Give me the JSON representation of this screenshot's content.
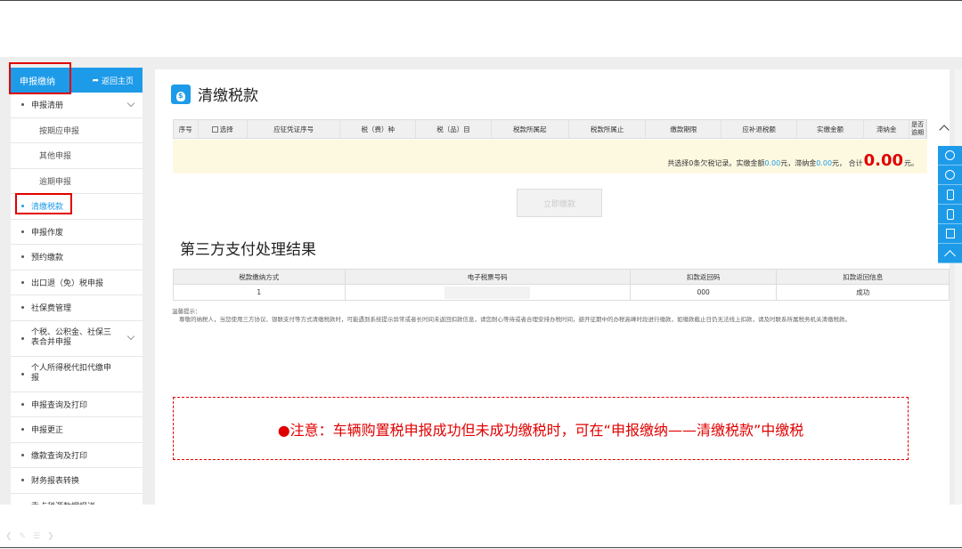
{
  "sidebar": {
    "header_title": "申报缴纳",
    "back_label": "返回主页",
    "items": [
      {
        "label": "申报清册",
        "type": "group",
        "expandable": true
      },
      {
        "label": "按期应申报",
        "type": "sub"
      },
      {
        "label": "其他申报",
        "type": "sub"
      },
      {
        "label": "逾期申报",
        "type": "sub"
      },
      {
        "label": "清缴税款",
        "type": "group",
        "active": true
      },
      {
        "label": "申报作废",
        "type": "group"
      },
      {
        "label": "预约缴款",
        "type": "group"
      },
      {
        "label": "出口退（免）税申报",
        "type": "group"
      },
      {
        "label": "社保费管理",
        "type": "group"
      },
      {
        "label": "个税、公积金、社保三表合并申报",
        "type": "group",
        "expandable": true
      },
      {
        "label": "个人所得税代扣代缴申报",
        "type": "group"
      },
      {
        "label": "申报查询及打印",
        "type": "group"
      },
      {
        "label": "申报更正",
        "type": "group"
      },
      {
        "label": "缴款查询及打印",
        "type": "group"
      },
      {
        "label": "财务报表转换",
        "type": "group"
      },
      {
        "label": "重点税源数据报送",
        "type": "group"
      }
    ]
  },
  "main": {
    "title": "清缴税款",
    "tax_table": {
      "columns": [
        "序号",
        "选择",
        "应征凭证序号",
        "税（费）种",
        "税（品）目",
        "税款所属起",
        "税款所属止",
        "缴款期限",
        "应补退税额",
        "实缴金额",
        "滞纳金",
        "是否逾期"
      ]
    },
    "summary": {
      "prefix": "共选择0条欠税记录。实缴金额",
      "paid_amount": "0.00",
      "mid1": " 元，滞纳金 ",
      "late_fee": "0.00",
      "mid2": "元， 合计",
      "total": "0.00",
      "suffix": "元。"
    },
    "pay_button": "立即缴款",
    "third_party_title": "第三方支付处理结果",
    "result_table": {
      "columns": [
        "税款缴纳方式",
        "电子税票号码",
        "扣款返回码",
        "扣款返回信息"
      ],
      "rows": [
        {
          "method": "1",
          "ticket_no": "",
          "return_code": "000",
          "return_msg": "成功"
        }
      ]
    },
    "tips": {
      "heading": "温馨提示：",
      "body": "尊敬的纳税人，当您使用三方协议、银联支付等方式清缴税款时，可能遇到系统提示异常或者长时间未返回扣款信息，请您耐心等待或者合理安排办税时间，避开征期中的办税高峰时段进行缴款，如缴款截止日仍无法线上扣款，请及时联系所属税务机关清缴税款。"
    },
    "notice": "●注意：车辆购置税申报成功但未成功缴税时，可在“申报缴纳——清缴税款”中缴税"
  },
  "float_tools": [
    "wechat-icon",
    "weibo-icon",
    "mobile-icon",
    "app-icon",
    "feedback-icon",
    "back-to-top-icon"
  ],
  "colors": {
    "brand": "#1e9be8",
    "highlight": "#e00000",
    "summary_bg": "#fdf9e1"
  }
}
